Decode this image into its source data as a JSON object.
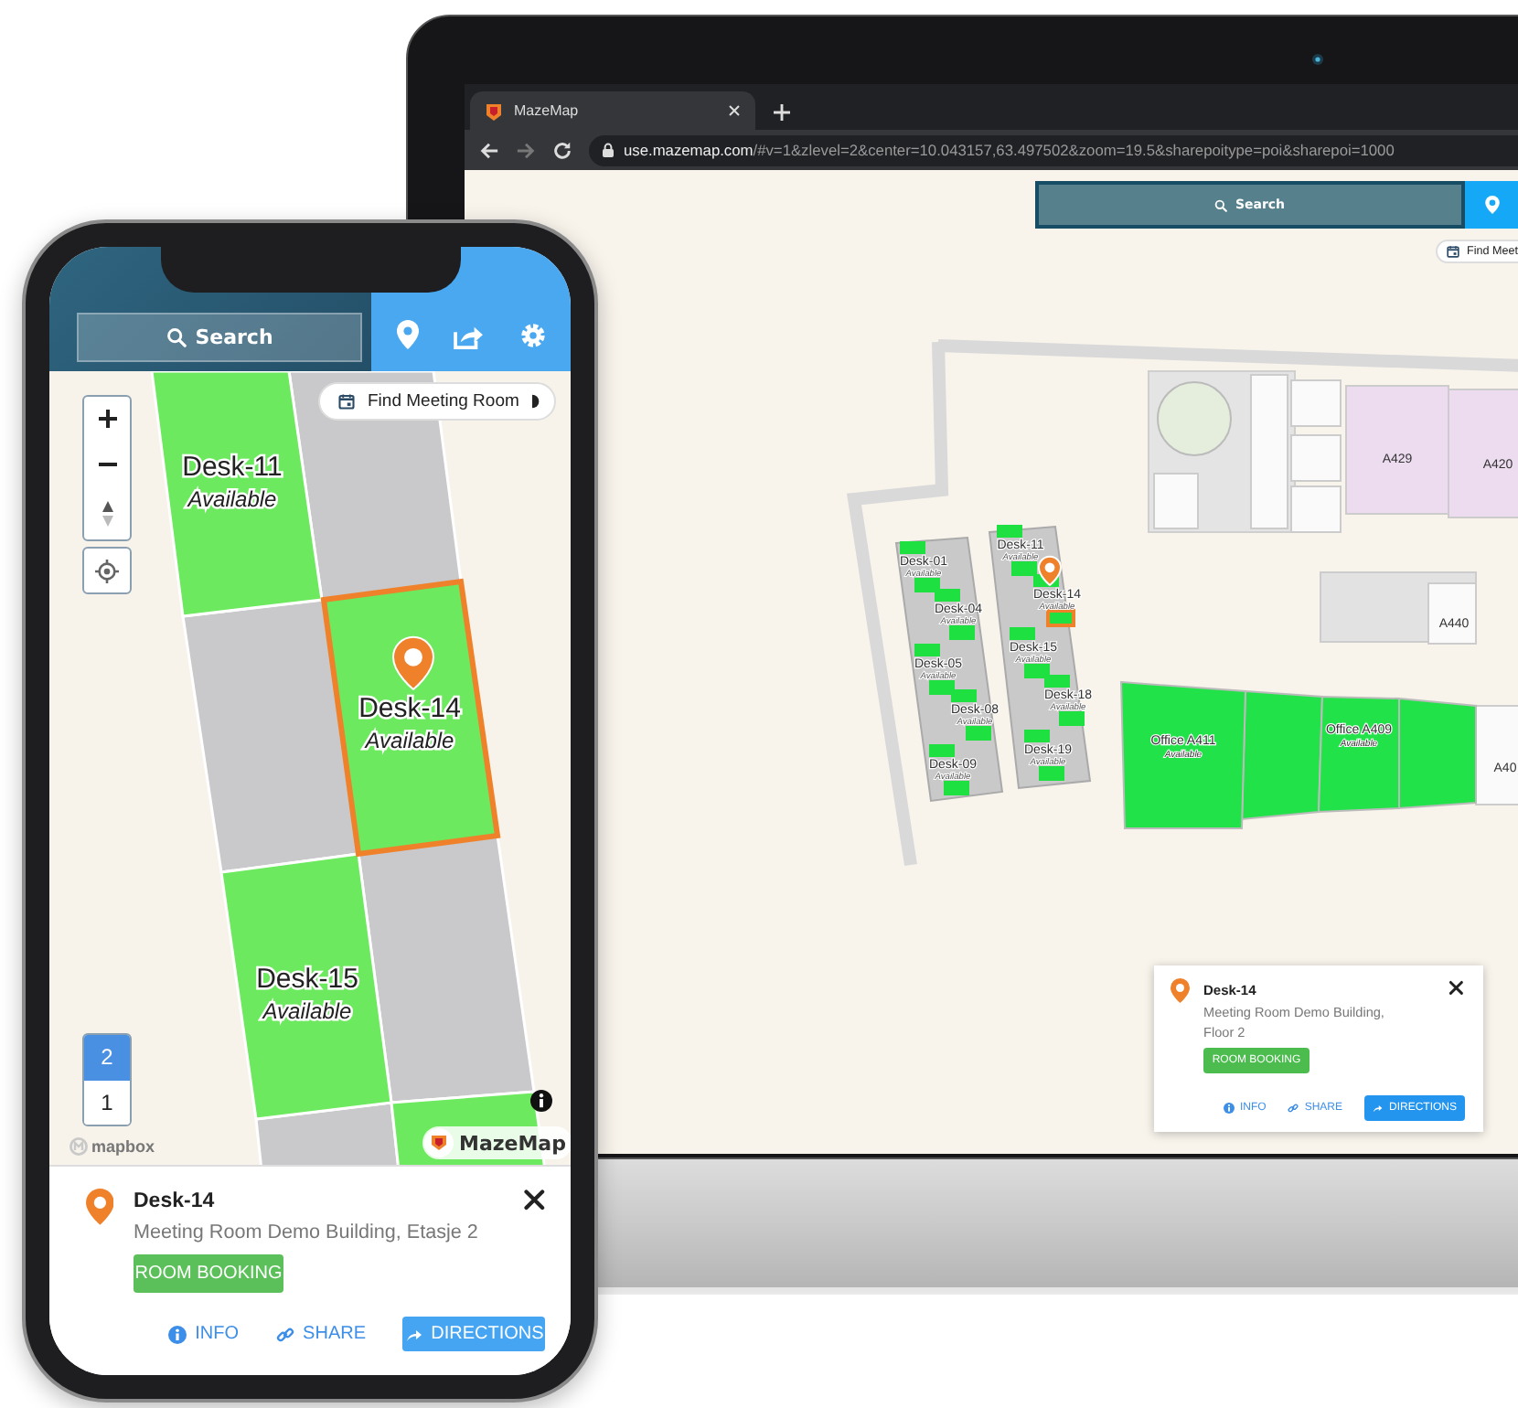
{
  "laptop": {
    "browser": {
      "tab_title": "MazeMap",
      "url_host": "use.mazemap.com",
      "url_path": "/#v=1&zlevel=2&center=10.043157,63.497502&zoom=19.5&sharepoitype=poi&sharepoi=1000"
    },
    "search_label": "Search",
    "find_room_label": "Find Meet",
    "rooms": [
      {
        "label": "A429",
        "kind": "meeting"
      },
      {
        "label": "A420",
        "kind": "meeting"
      },
      {
        "label": "A440",
        "kind": "plain"
      },
      {
        "label": "A40",
        "kind": "plain"
      }
    ],
    "offices": [
      {
        "name": "Office A411",
        "status": "Available"
      },
      {
        "name": "Office A409",
        "status": "Available"
      }
    ],
    "desks": [
      {
        "name": "Desk-01",
        "status": "Available",
        "selected": false
      },
      {
        "name": "Desk-04",
        "status": "Available",
        "selected": false
      },
      {
        "name": "Desk-05",
        "status": "Available",
        "selected": false
      },
      {
        "name": "Desk-08",
        "status": "Available",
        "selected": false
      },
      {
        "name": "Desk-09",
        "status": "Available",
        "selected": false
      },
      {
        "name": "Desk-11",
        "status": "Available",
        "selected": false
      },
      {
        "name": "Desk-14",
        "status": "Available",
        "selected": true
      },
      {
        "name": "Desk-15",
        "status": "Available",
        "selected": false
      },
      {
        "name": "Desk-18",
        "status": "Available",
        "selected": false
      },
      {
        "name": "Desk-19",
        "status": "Available",
        "selected": false
      }
    ],
    "popup": {
      "title": "Desk-14",
      "address": "Meeting Room Demo Building, Floor 2",
      "booking": "ROOM BOOKING",
      "actions": [
        {
          "label": "INFO",
          "kind": "info"
        },
        {
          "label": "SHARE",
          "kind": "share"
        },
        {
          "label": "DIRECTIONS",
          "kind": "directions"
        }
      ]
    }
  },
  "phone": {
    "search_label": "Search",
    "find_room_label": "Find Meeting Room",
    "desks": [
      {
        "name": "Desk-11",
        "status": "Available",
        "selected": false
      },
      {
        "name": "Desk-14",
        "status": "Available",
        "selected": true
      },
      {
        "name": "Desk-15",
        "status": "Available",
        "selected": false
      }
    ],
    "floors": [
      {
        "label": "2",
        "selected": true
      },
      {
        "label": "1",
        "selected": false
      }
    ],
    "attribution": "mapbox",
    "brand": "MazeMap",
    "popup": {
      "title": "Desk-14",
      "address": "Meeting Room Demo Building, Etasje 2",
      "booking": "ROOM BOOKING",
      "actions": [
        {
          "label": "INFO",
          "kind": "info"
        },
        {
          "label": "SHARE",
          "kind": "share"
        },
        {
          "label": "DIRECTIONS",
          "kind": "directions"
        }
      ]
    }
  }
}
